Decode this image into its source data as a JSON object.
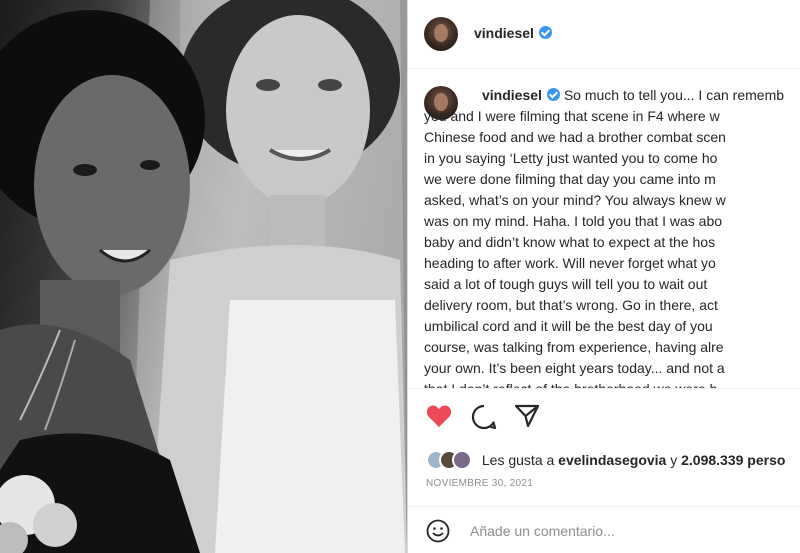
{
  "post": {
    "username": "vindiesel",
    "caption_lines": [
      "So much to tell you... I can rememb",
      "you and I were filming that scene in F4 where w",
      "Chinese food and we had a brother combat scen",
      "in you saying ‘Letty just wanted you to come ho",
      "we were done filming that day you came into m",
      "asked, what’s on your mind? You always knew w",
      "was on my mind. Haha. I told you that I was abo",
      "baby and didn’t know what to expect at the hos",
      "heading to after work. Will never forget what yo",
      "said a lot of tough guys will tell you to wait out",
      "delivery room, but that’s wrong. Go in there, act",
      "umbilical cord and it will be the best day of you",
      "course, was talking from experience, having alre",
      "your own. It’s been eight years today... and not a",
      "that I don’t reflect of the brotherhood we were b"
    ],
    "likes": {
      "prefix": "Les gusta a",
      "user": "evelindasegovia",
      "conj": "y",
      "count": "2.098.339 perso"
    },
    "date": "NOVIEMBRE 30, 2021",
    "comment_placeholder": "Añade un comentario...",
    "icons": [
      "heart-icon",
      "comment-icon",
      "share-icon",
      "emoji-icon",
      "verified-badge-icon"
    ],
    "colors": {
      "heart": "#ed4956",
      "verified": "#3897f0",
      "muted": "#8e8e8e"
    }
  }
}
